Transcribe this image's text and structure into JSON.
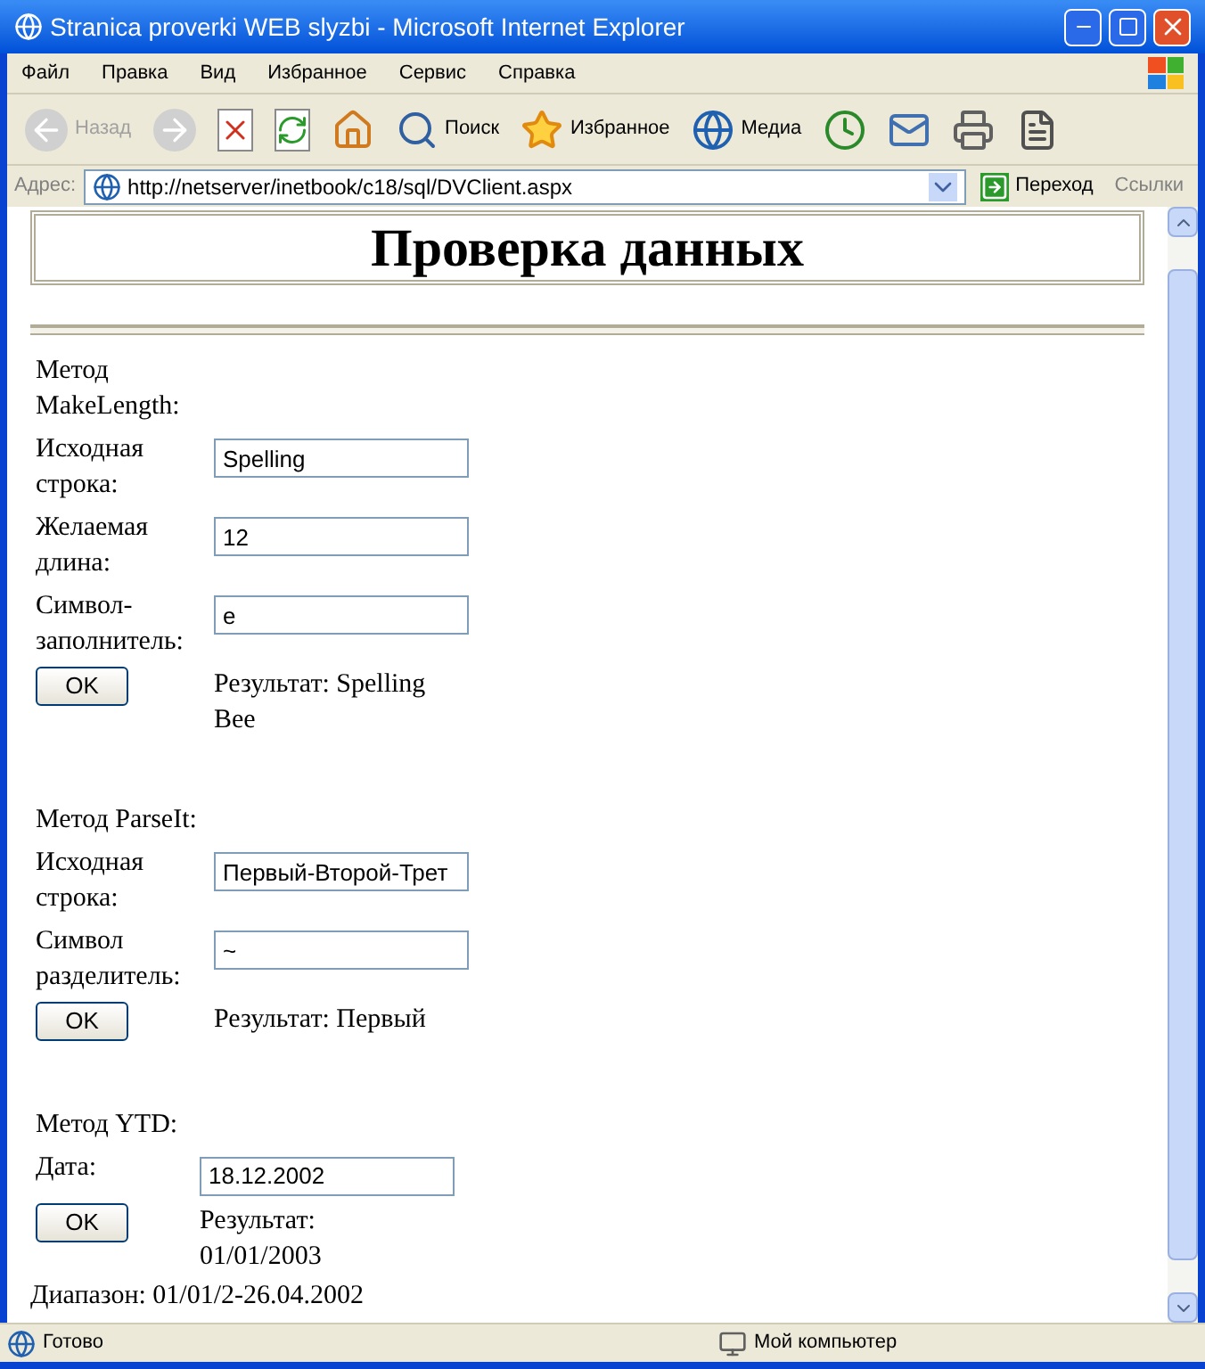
{
  "window": {
    "title": "Stranica proverki WEB slyzbi - Microsoft Internet Explorer"
  },
  "menu": [
    "Файл",
    "Правка",
    "Вид",
    "Избранное",
    "Сервис",
    "Справка"
  ],
  "toolbar": [
    {
      "kind": "back",
      "label": "Назад",
      "disabled": true
    },
    {
      "kind": "forward",
      "disabled": true
    },
    {
      "kind": "stop"
    },
    {
      "kind": "refresh"
    },
    {
      "kind": "home"
    },
    {
      "kind": "search",
      "label": "Поиск"
    },
    {
      "kind": "favorites",
      "label": "Избранное"
    },
    {
      "kind": "media",
      "label": "Медиа"
    },
    {
      "kind": "history"
    },
    {
      "kind": "mail"
    },
    {
      "kind": "print"
    },
    {
      "kind": "edit"
    }
  ],
  "address_bar": {
    "label": "Адрес:",
    "url": "http://netserver/inetbook/c18/sql/DVClient.aspx",
    "go": "Переход",
    "links": "Ссылки"
  },
  "page": {
    "heading": "Проверка данных",
    "sections": [
      {
        "title": "Метод MakeLength:",
        "fields": [
          {
            "label": "Исходная строка:",
            "value": "Spelling"
          },
          {
            "label": "Желаемая длина:",
            "value": "12"
          },
          {
            "label": "Символ-заполнитель:",
            "value": "e"
          }
        ],
        "button": "OK",
        "result": "Результат: Spelling Bee"
      },
      {
        "title": "Метод ParseIt:",
        "fields": [
          {
            "label": "Исходная строка:",
            "value": "Первый-Второй-Трет"
          },
          {
            "label": "Символ разделитель:",
            "value": "~"
          }
        ],
        "button": "OK",
        "result": "Результат: Первый"
      },
      {
        "title": "Метод YTD:",
        "fields": [
          {
            "label": "Дата:",
            "value": "18.12.2002"
          }
        ],
        "button": "OK",
        "result": "Результат: 01/01/2003"
      }
    ],
    "footer": "Диапазон: 01/01/2-26.04.2002"
  },
  "status_bar": {
    "text": "Готово",
    "zone": "Мой компьютер"
  }
}
